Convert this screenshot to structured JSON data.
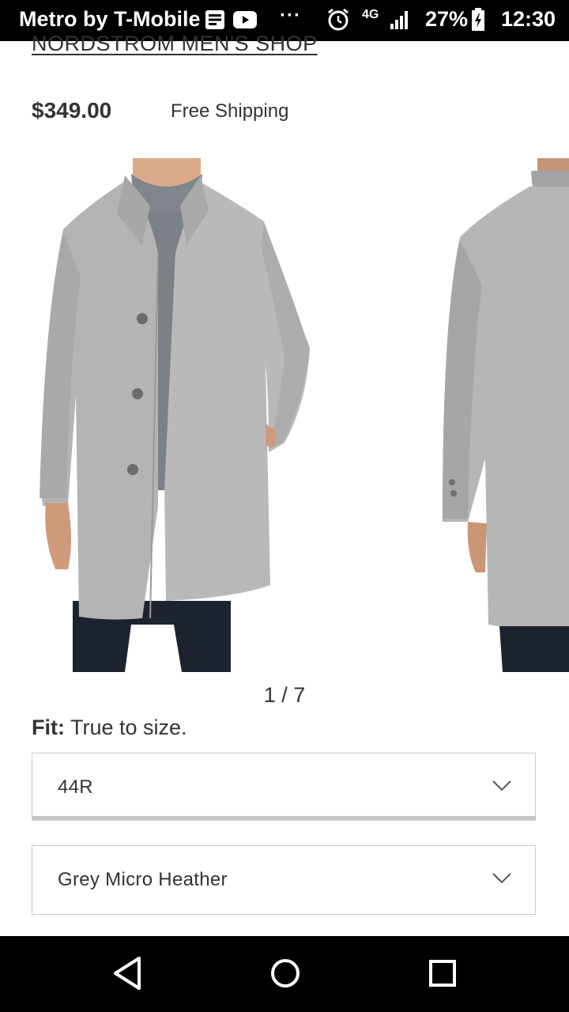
{
  "status_bar": {
    "carrier": "Metro by T-Mobile",
    "overflow": "···",
    "network": "4G",
    "battery": "27%",
    "time": "12:30",
    "icons": [
      "notes-icon",
      "youtube-icon",
      "alarm-icon",
      "signal-icon",
      "battery-icon"
    ]
  },
  "product": {
    "brand_link": "NORDSTROM MEN'S SHOP",
    "price": "$349.00",
    "shipping": "Free Shipping",
    "gallery_counter": "1 / 7",
    "fit_label": "Fit:",
    "fit_value": " True to size.",
    "size_select": {
      "value": "44R"
    },
    "color_select": {
      "value": "Grey Micro Heather"
    }
  },
  "nav_bar": {
    "icons": [
      "back-icon",
      "home-icon",
      "recents-icon"
    ]
  }
}
